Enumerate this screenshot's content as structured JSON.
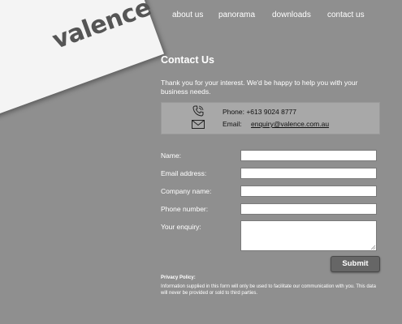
{
  "logo": {
    "text": "valence"
  },
  "nav": {
    "items": [
      {
        "label": "about us"
      },
      {
        "label": "panorama"
      },
      {
        "label": "downloads"
      },
      {
        "label": "contact us"
      }
    ]
  },
  "main": {
    "title": "Contact Us",
    "intro": "Thank you for your interest. We'd be happy to help you with your business needs."
  },
  "contact": {
    "phone_label": "Phone:",
    "phone_value": "+613 9024 8777",
    "email_label": "Email:",
    "email_value": "enquiry@valence.com.au",
    "phone_icon": "phone-icon",
    "mail_icon": "mail-icon"
  },
  "form": {
    "name_label": "Name:",
    "email_label": "Email address:",
    "company_label": "Company name:",
    "phone_label": "Phone number:",
    "enquiry_label": "Your enquiry:",
    "name_value": "",
    "email_value": "",
    "company_value": "",
    "phone_value": "",
    "enquiry_value": "",
    "submit_label": "Submit"
  },
  "privacy": {
    "title": "Privacy Policy:",
    "text": "Information supplied in this form will only be used to facilitate our communication with you. This data will never be provided or sold to third parties."
  },
  "colors": {
    "background": "#8f8f8f",
    "contact_box": "#a8a8a8",
    "button": "#666666",
    "logo_card": "#f4f4f4",
    "logo_text": "#555555"
  }
}
